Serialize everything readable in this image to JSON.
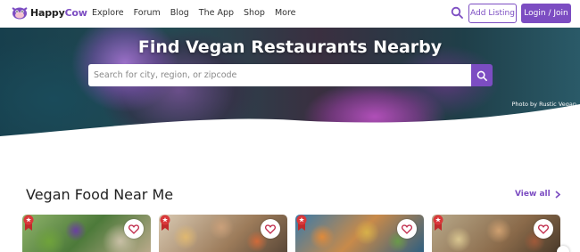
{
  "nav": {
    "logo": {
      "part1": "Happy",
      "part2": "Cow"
    },
    "menu": [
      "Explore",
      "Forum",
      "Blog",
      "The App",
      "Shop",
      "More"
    ],
    "add_listing": "Add Listing",
    "login": "Login / Join",
    "search_icon": "search-icon"
  },
  "hero": {
    "title": "Find Vegan Restaurants Nearby",
    "search_placeholder": "Search for city, region, or zipcode",
    "photo_credit": "Photo by Rustic Vegan"
  },
  "section": {
    "title": "Vegan Food Near Me",
    "view_all": "View all"
  },
  "cards": [
    {
      "icon": "award-badge-icon",
      "fav_icon": "heart-icon"
    },
    {
      "icon": "award-badge-icon",
      "fav_icon": "heart-icon"
    },
    {
      "icon": "award-badge-icon",
      "fav_icon": "heart-icon"
    },
    {
      "icon": "award-badge-icon",
      "fav_icon": "heart-icon"
    }
  ],
  "colors": {
    "brand": "#7c4dc2",
    "text": "#222222"
  }
}
